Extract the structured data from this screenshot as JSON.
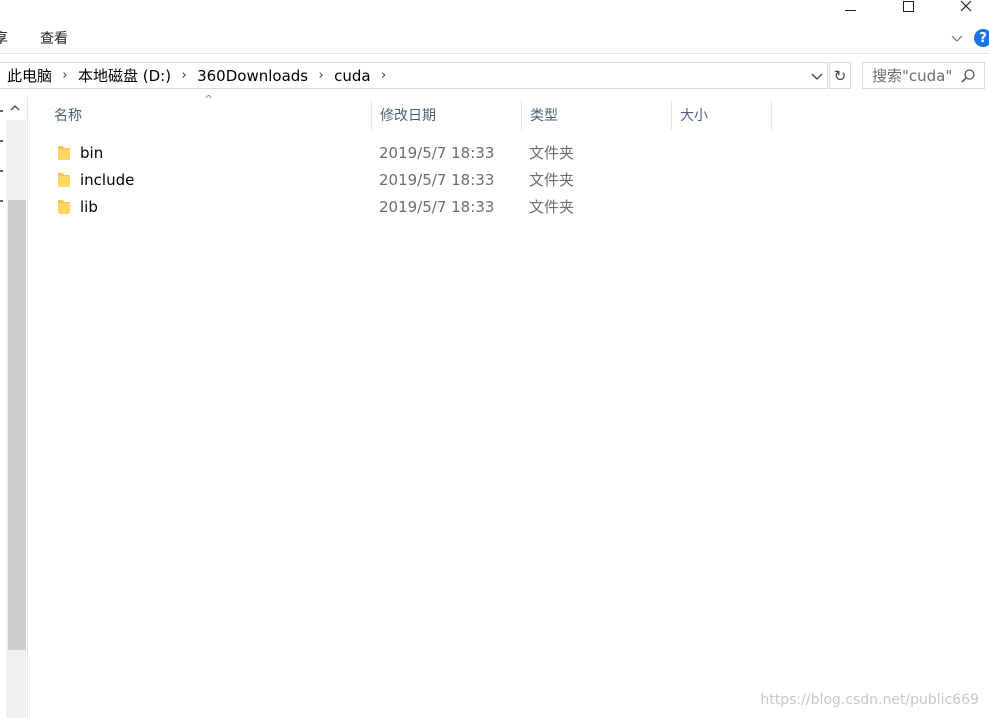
{
  "window": {
    "minimize_glyph": "—",
    "maximize_glyph": "☐",
    "close_glyph": "✕"
  },
  "ribbon": {
    "tabs": [
      "享",
      "查看"
    ],
    "collapse_glyph": "∨",
    "help_glyph": "?"
  },
  "address_bar": {
    "crumbs": [
      "此电脑",
      "本地磁盘 (D:)",
      "360Downloads",
      "cuda"
    ],
    "separator_glyph": "›",
    "dropdown_glyph": "∨",
    "refresh_glyph": "↻"
  },
  "search": {
    "placeholder": "搜索\"cuda\""
  },
  "columns": {
    "name": "名称",
    "modified": "修改日期",
    "type": "类型",
    "size": "大小",
    "sort_indicator": "^"
  },
  "files": [
    {
      "name": "bin",
      "modified": "2019/5/7 18:33",
      "type": "文件夹",
      "icon": "folder-icon"
    },
    {
      "name": "include",
      "modified": "2019/5/7 18:33",
      "type": "文件夹",
      "icon": "folder-icon"
    },
    {
      "name": "lib",
      "modified": "2019/5/7 18:33",
      "type": "文件夹",
      "icon": "folder-icon"
    }
  ],
  "watermark": "https://blog.csdn.net/public669",
  "colors": {
    "folder": "#f4c64e",
    "help_badge": "#1a73e8",
    "header_text": "#4c607a"
  }
}
